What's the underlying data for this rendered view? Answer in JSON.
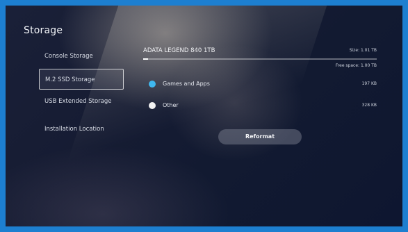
{
  "page": {
    "title": "Storage"
  },
  "sidebar": {
    "items": [
      {
        "label": "Console Storage",
        "selected": false
      },
      {
        "label": "M.2 SSD Storage",
        "selected": true
      },
      {
        "label": "USB Extended Storage",
        "selected": false
      },
      {
        "label": "Installation Location",
        "selected": false
      }
    ]
  },
  "device": {
    "name": "ADATA LEGEND 840 1TB",
    "size": "Size: 1.01 TB",
    "free_space": "Free space: 1.00 TB",
    "used_fraction": 0.01
  },
  "categories": [
    {
      "label": "Games and Apps",
      "value": "197 KB",
      "color": "#3fb8f0"
    },
    {
      "label": "Other",
      "value": "328 KB",
      "color": "#f2f2f2"
    }
  ],
  "actions": {
    "reformat_label": "Reformat"
  },
  "colors": {
    "frame": "#1d7fd0",
    "accent": "#3fb8f0"
  }
}
